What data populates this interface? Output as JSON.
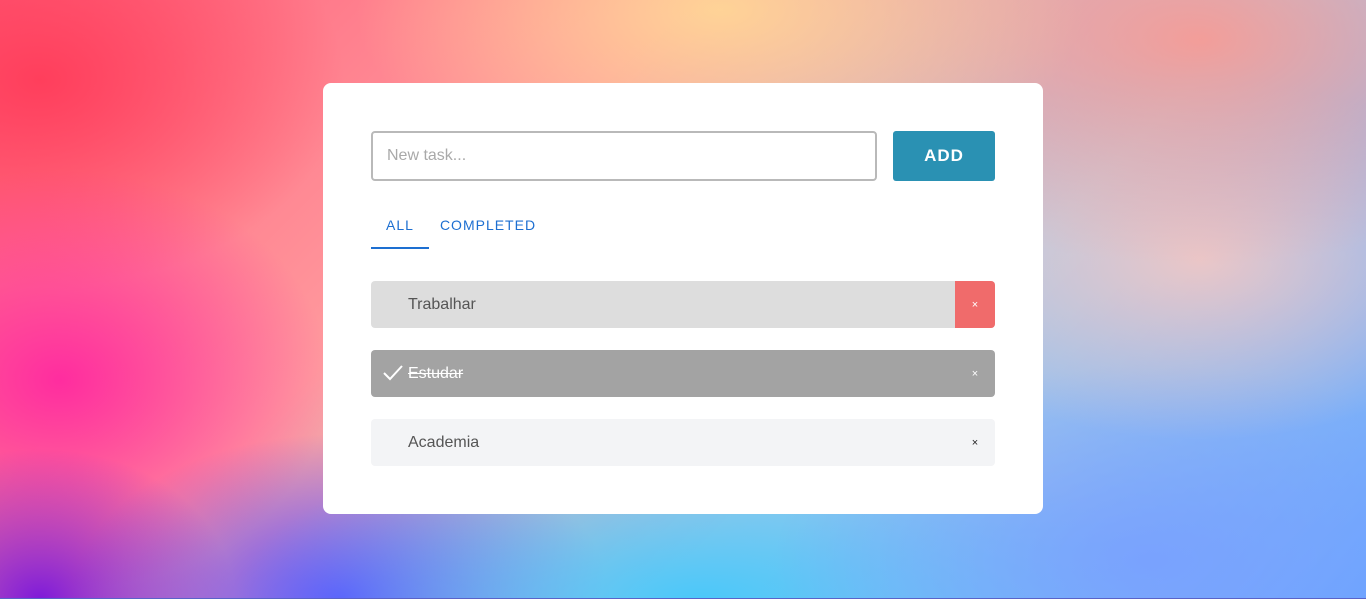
{
  "new_task": {
    "placeholder": "New task...",
    "value": "",
    "add_label": "ADD"
  },
  "tabs": [
    {
      "label": "ALL",
      "selected": true
    },
    {
      "label": "COMPLETED",
      "selected": false
    }
  ],
  "tasks": [
    {
      "text": "Trabalhar",
      "completed": false,
      "delete_label": "×"
    },
    {
      "text": "Estudar",
      "completed": true,
      "delete_label": "×"
    },
    {
      "text": "Academia",
      "completed": false,
      "delete_label": "×"
    }
  ],
  "colors": {
    "accent": "#2a91b3",
    "tab_blue": "#1d6fd1",
    "delete_red": "#f06b6b",
    "completed_gray": "#a3a3a3"
  }
}
